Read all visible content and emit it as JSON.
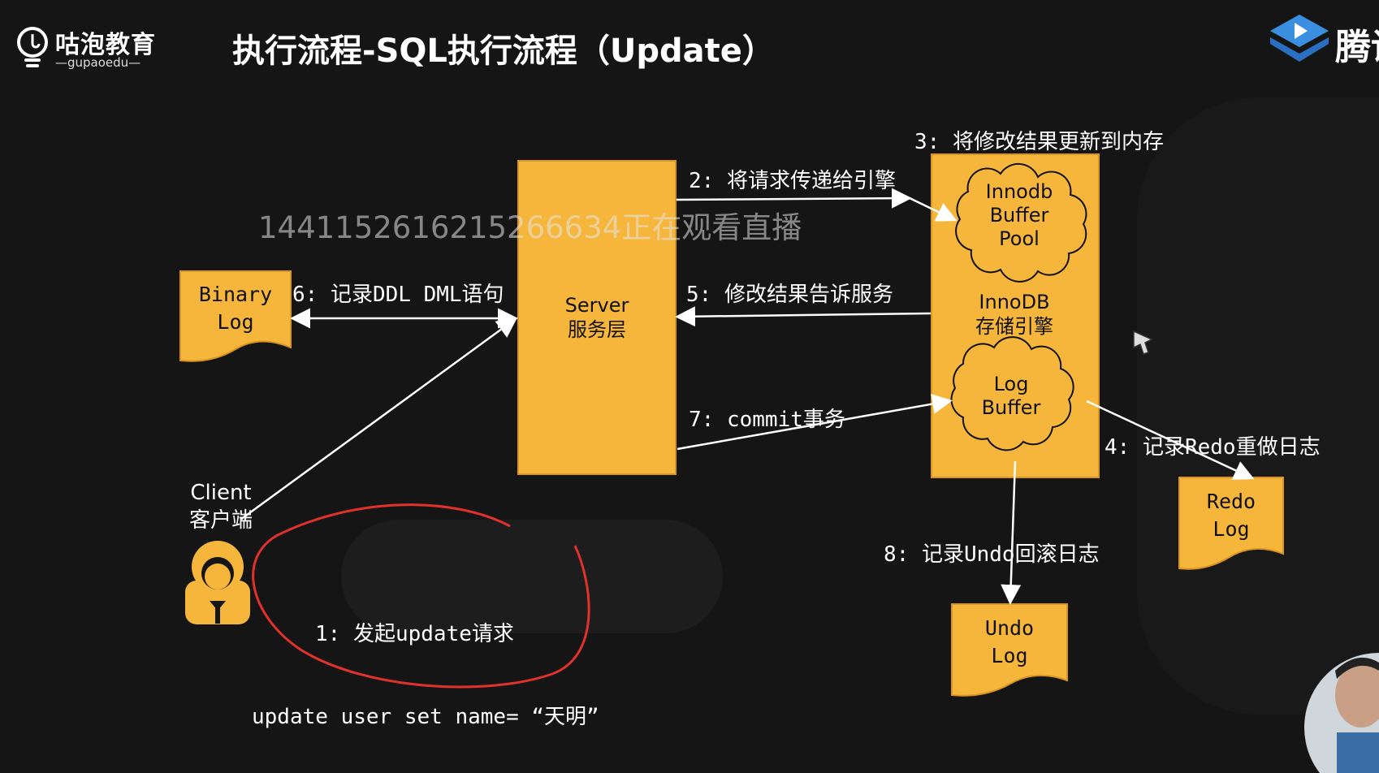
{
  "header": {
    "brand_name": "咕泡教育",
    "brand_sub": "—gupaoedu—",
    "title": "执行流程-SQL执行流程（Update）",
    "corner_text": "腾讯"
  },
  "watermark": "1441152616215266634正在观看直播",
  "nodes": {
    "server": [
      "Server",
      "服务层"
    ],
    "innodb_engine": [
      "InnoDB",
      "存储引擎"
    ],
    "buffer_pool": [
      "Innodb",
      "Buffer",
      "Pool"
    ],
    "log_buffer": [
      "Log",
      "Buffer"
    ],
    "binary_log": [
      "Binary",
      "Log"
    ],
    "redo_log": [
      "Redo",
      "Log"
    ],
    "undo_log": [
      "Undo",
      "Log"
    ],
    "client": [
      "Client",
      "客户端"
    ]
  },
  "steps": {
    "s1": "1: 发起update请求",
    "s1_sql": "update user set name= “天明”",
    "s2": "2: 将请求传递给引擎",
    "s3": "3: 将修改结果更新到内存",
    "s4": "4: 记录Redo重做日志",
    "s5": "5: 修改结果告诉服务",
    "s6": "6: 记录DDL DML语句",
    "s7": "7: commit事务",
    "s8": "8: 记录Undo回滚日志"
  },
  "colors": {
    "box_fill": "#f5b63b",
    "annotation": "#e0312b",
    "background": "#151515"
  }
}
